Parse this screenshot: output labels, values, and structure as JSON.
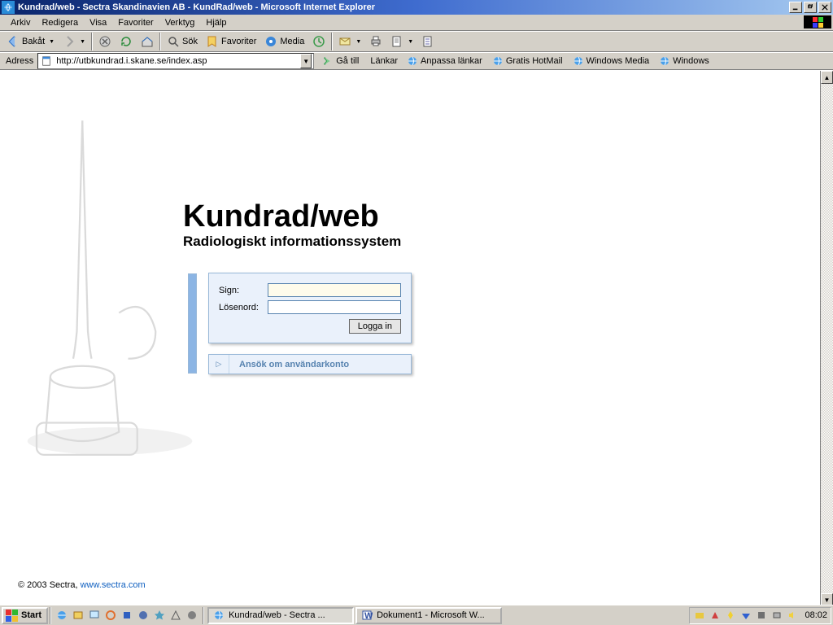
{
  "window": {
    "title": "Kundrad/web - Sectra Skandinavien AB - KundRad/web - Microsoft Internet Explorer"
  },
  "menu": {
    "items": [
      "Arkiv",
      "Redigera",
      "Visa",
      "Favoriter",
      "Verktyg",
      "Hjälp"
    ]
  },
  "toolbar": {
    "back": "Bakåt",
    "search": "Sök",
    "favorites": "Favoriter",
    "media": "Media"
  },
  "address": {
    "label": "Adress",
    "url": "http://utbkundrad.i.skane.se/index.asp",
    "go": "Gå till",
    "links_label": "Länkar",
    "links": [
      "Anpassa länkar",
      "Gratis HotMail",
      "Windows Media",
      "Windows"
    ]
  },
  "page": {
    "title": "Kundrad/web",
    "tagline": "Radiologiskt informationssystem",
    "sign_label": "Sign:",
    "password_label": "Lösenord:",
    "login_button": "Logga in",
    "apply_link": "Ansök om användarkonto",
    "copyright_prefix": "© 2003 Sectra, ",
    "copyright_link": "www.sectra.com"
  },
  "taskbar": {
    "start": "Start",
    "task1": "Kundrad/web - Sectra ...",
    "task2": "Dokument1 - Microsoft W...",
    "clock": "08:02"
  },
  "colors": {
    "panel_bg": "#eaf1fb",
    "panel_border": "#98b8d8",
    "link_blue": "#5783b0"
  }
}
